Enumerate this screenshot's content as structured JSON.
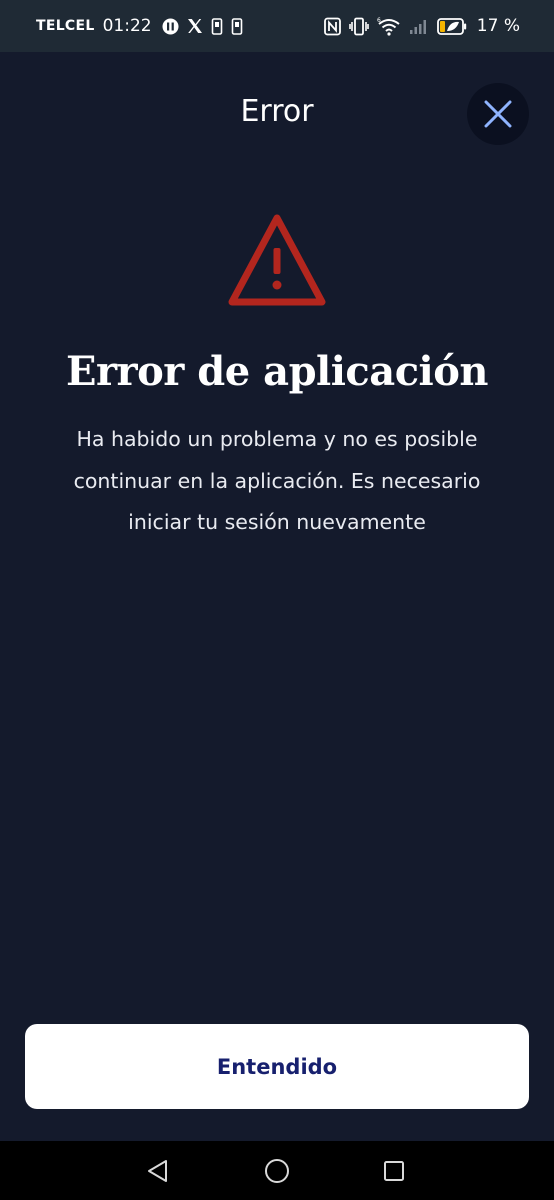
{
  "status_bar": {
    "carrier": "TELCEL",
    "time": "01:22",
    "battery_percent": "17 %",
    "icons": [
      "notification-app-icon",
      "x-logo-icon",
      "phone-notification-icon",
      "phone-notification-icon",
      "nfc-icon",
      "vibrate-icon",
      "wifi-icon",
      "signal-icon",
      "battery-icon"
    ]
  },
  "header": {
    "title": "Error",
    "close_icon": "close-icon"
  },
  "content": {
    "icon": "warning-icon",
    "icon_color": "#b3261e",
    "heading": "Error de aplicación",
    "message": "Ha habido un problema y no es posible continuar en la aplicación. Es necesario iniciar tu sesión nuevamente"
  },
  "actions": {
    "primary_label": "Entendido",
    "primary_color": "#17206e"
  },
  "nav_bar": {
    "icons": [
      "back-icon",
      "home-icon",
      "recents-icon"
    ]
  },
  "colors": {
    "background": "#141a2c",
    "status_bar": "#1f2a35",
    "close_accent": "#8fb4ff"
  }
}
